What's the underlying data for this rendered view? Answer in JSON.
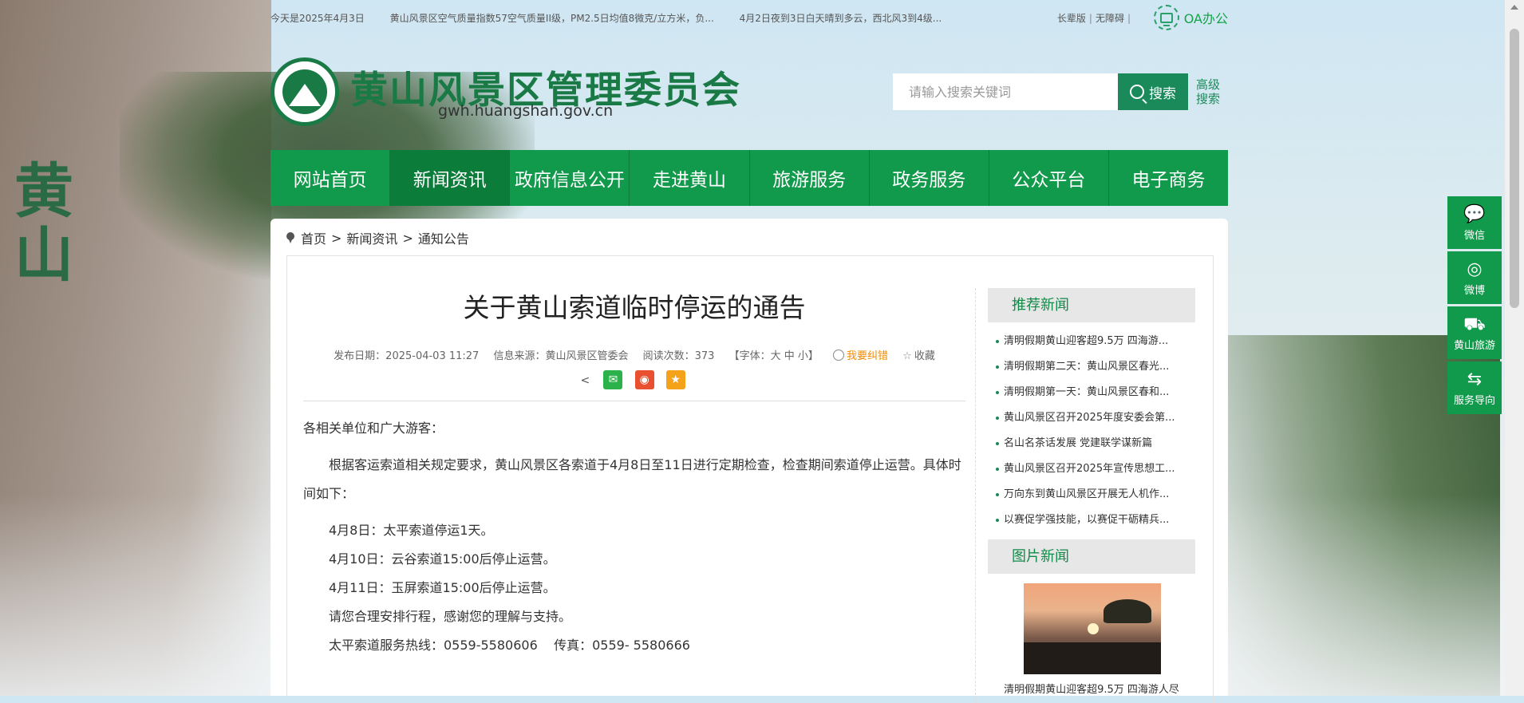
{
  "topbar": {
    "weather": [
      "今天是2025年4月3日",
      "黄山风景区空气质量指数57空气质量II级，PM2.5日均值8微克/立方米，负...",
      "4月2日夜到3日白天晴到多云，西北风3到4级..."
    ],
    "links": [
      "长辈版",
      "无障碍"
    ],
    "oa_label": "OA办公"
  },
  "header": {
    "site_title": "黄山风景区管理委员会",
    "site_url": "gwh.huangshan.gov.cn",
    "search_placeholder": "请输入搜索关键词",
    "search_button": "搜索",
    "advanced_search": "高级搜索"
  },
  "nav": {
    "items": [
      "网站首页",
      "新闻资讯",
      "政府信息公开",
      "走进黄山",
      "旅游服务",
      "政务服务",
      "公众平台",
      "电子商务"
    ],
    "active": "新闻资讯"
  },
  "breadcrumb": {
    "home": "首页",
    "section": "新闻资讯",
    "page": "通知公告"
  },
  "article": {
    "title": "关于黄山索道临时停运的通告",
    "publish_date": "发布日期：2025-04-03 11:27",
    "source": "信息来源：黄山风景区管委会",
    "views": "阅读次数：373",
    "font_size": "【字体：大 中 小】",
    "correction": "我要纠错",
    "favorite": "收藏",
    "paragraphs": {
      "p1": "各相关单位和广大游客：",
      "p2": "根据客运索道相关规定要求，黄山风景区各索道于4月8日至11日进行定期检查，检查期间索道停止运营。具体时间如下：",
      "p3": "4月8日：太平索道停运1天。",
      "p4": "4月10日：云谷索道15:00后停止运营。",
      "p5": "4月11日：玉屏索道15:00后停止运营。",
      "p6": "请您合理安排行程，感谢您的理解与支持。",
      "p7": "太平索道服务热线：0559-5580606    传真：0559- 5580666"
    }
  },
  "sidebar": {
    "recommended_title": "推荐新闻",
    "recommended": [
      "清明假期黄山迎客超9.5万 四海游...",
      "清明假期第二天：黄山风景区春光...",
      "清明假期第一天：黄山风景区春和...",
      "黄山风景区召开2025年度安委会第...",
      "名山名茶话发展 党建联学谋新篇",
      "黄山风景区召开2025年宣传思想工...",
      "万向东到黄山风景区开展无人机作...",
      "以赛促学强技能，以赛促干砺精兵..."
    ],
    "photo_title": "图片新闻",
    "photo_caption": "清明假期黄山迎客超9.5万 四海游人尽"
  },
  "float_bar": [
    "微信",
    "微博",
    "黄山旅游",
    "服务导向"
  ],
  "colors": {
    "brand_green": "#119a4b",
    "dark_green": "#1a7a45",
    "accent_orange": "#f08a00"
  }
}
